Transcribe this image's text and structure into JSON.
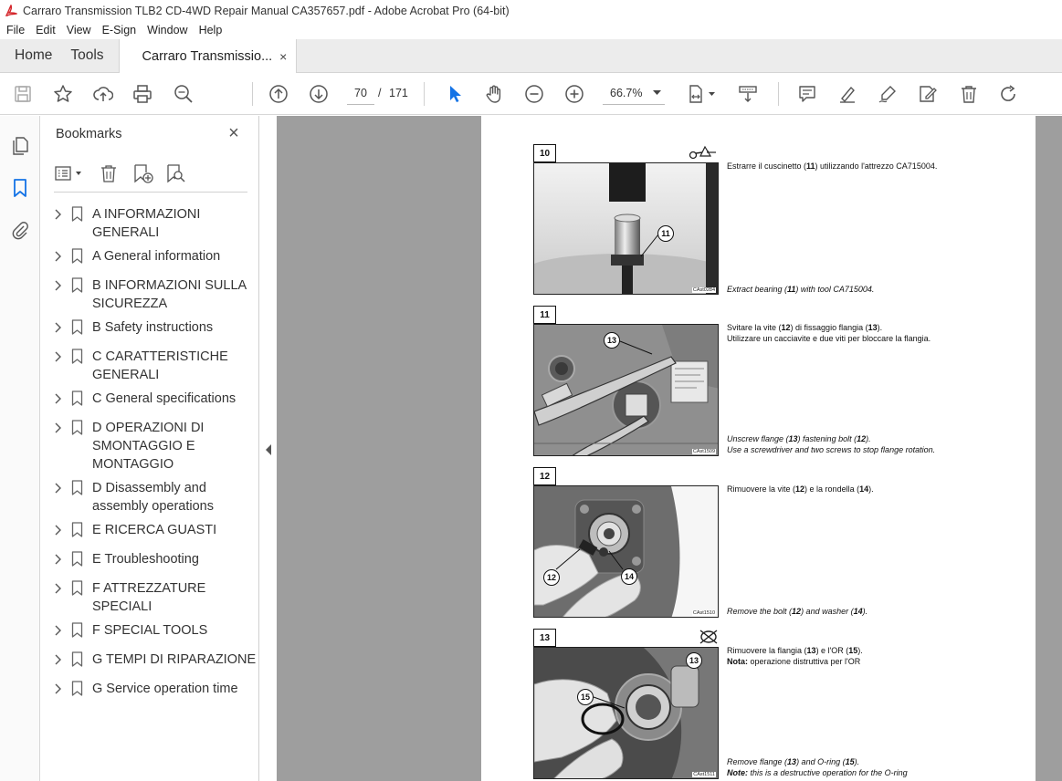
{
  "window": {
    "title": "Carraro Transmission TLB2 CD-4WD Repair Manual CA357657.pdf - Adobe Acrobat Pro (64-bit)"
  },
  "menu": [
    "File",
    "Edit",
    "View",
    "E-Sign",
    "Window",
    "Help"
  ],
  "tabs": {
    "home": "Home",
    "tools": "Tools",
    "document": "Carraro Transmissio...",
    "close": "×"
  },
  "toolbar": {
    "current_page": "70",
    "page_separator": "/",
    "total_pages": "171",
    "zoom": "66.7%",
    "icons": [
      "save-icon",
      "star-icon",
      "upload-icon",
      "print-icon",
      "zoom-search-icon",
      "page-up-icon",
      "page-down-icon",
      "select-cursor-icon",
      "hand-icon",
      "zoom-out-icon",
      "zoom-in-icon",
      "page-fit-icon",
      "scroll-mode-icon",
      "comment-icon",
      "highlight-icon",
      "sign-icon",
      "fill-sign-icon",
      "delete-icon",
      "redo-icon"
    ]
  },
  "bookmarks": {
    "title": "Bookmarks",
    "close": "×",
    "items": [
      {
        "label": "A INFORMAZIONI GENERALI"
      },
      {
        "label": "A General information"
      },
      {
        "label": "B INFORMAZIONI SULLA SICUREZZA"
      },
      {
        "label": "B Safety instructions"
      },
      {
        "label": "C CARATTERISTICHE GENERALI"
      },
      {
        "label": "C General specifications"
      },
      {
        "label": "D OPERAZIONI DI SMONTAGGIO E MONTAGGIO"
      },
      {
        "label": "D Disassembly and assembly operations"
      },
      {
        "label": "E RICERCA GUASTI"
      },
      {
        "label": "E Troubleshooting"
      },
      {
        "label": "F ATTREZZATURE SPECIALI"
      },
      {
        "label": "F SPECIAL TOOLS"
      },
      {
        "label": "G TEMPI DI RIPARAZIONE"
      },
      {
        "label": "G Service operation time"
      }
    ]
  },
  "document": {
    "steps": [
      {
        "number": "10",
        "code": "CAst0284",
        "callouts": [
          "11"
        ],
        "it": [
          "Estrarre il cuscinetto (",
          "11",
          ") utilizzando l'attrezzo CA715004."
        ],
        "en": [
          "Extract bearing (",
          "11",
          ") with tool CA715004."
        ]
      },
      {
        "number": "11",
        "code": "CAst1509",
        "callouts": [
          "13"
        ],
        "it": [
          "Svitare la vite (",
          "12",
          ") di fissaggio flangia (",
          "13",
          ").",
          "Utilizzare un cacciavite e due viti per bloccare la flangia."
        ],
        "en": [
          "Unscrew flange (",
          "13",
          ") fastening bolt (",
          "12",
          ").",
          "Use a screwdriver and two screws to stop flange rotation."
        ]
      },
      {
        "number": "12",
        "code": "CAst1510",
        "callouts": [
          "12",
          "14"
        ],
        "it": [
          "Rimuovere la vite (",
          "12",
          ") e la rondella (",
          "14",
          ")."
        ],
        "en": [
          "Remove the bolt (",
          "12",
          ") and washer (",
          "14",
          ")."
        ]
      },
      {
        "number": "13",
        "code": "CAst1511",
        "callouts": [
          "13",
          "15"
        ],
        "it": [
          "Rimuovere la flangia (",
          "13",
          ") e l'OR (",
          "15",
          ").",
          "Nota:",
          " operazione distruttiva per l'OR"
        ],
        "en": [
          "Remove flange (",
          "13",
          ") and O-ring (",
          "15",
          ").",
          "Note:",
          " this is a destructive operation for the O-ring"
        ]
      }
    ]
  }
}
